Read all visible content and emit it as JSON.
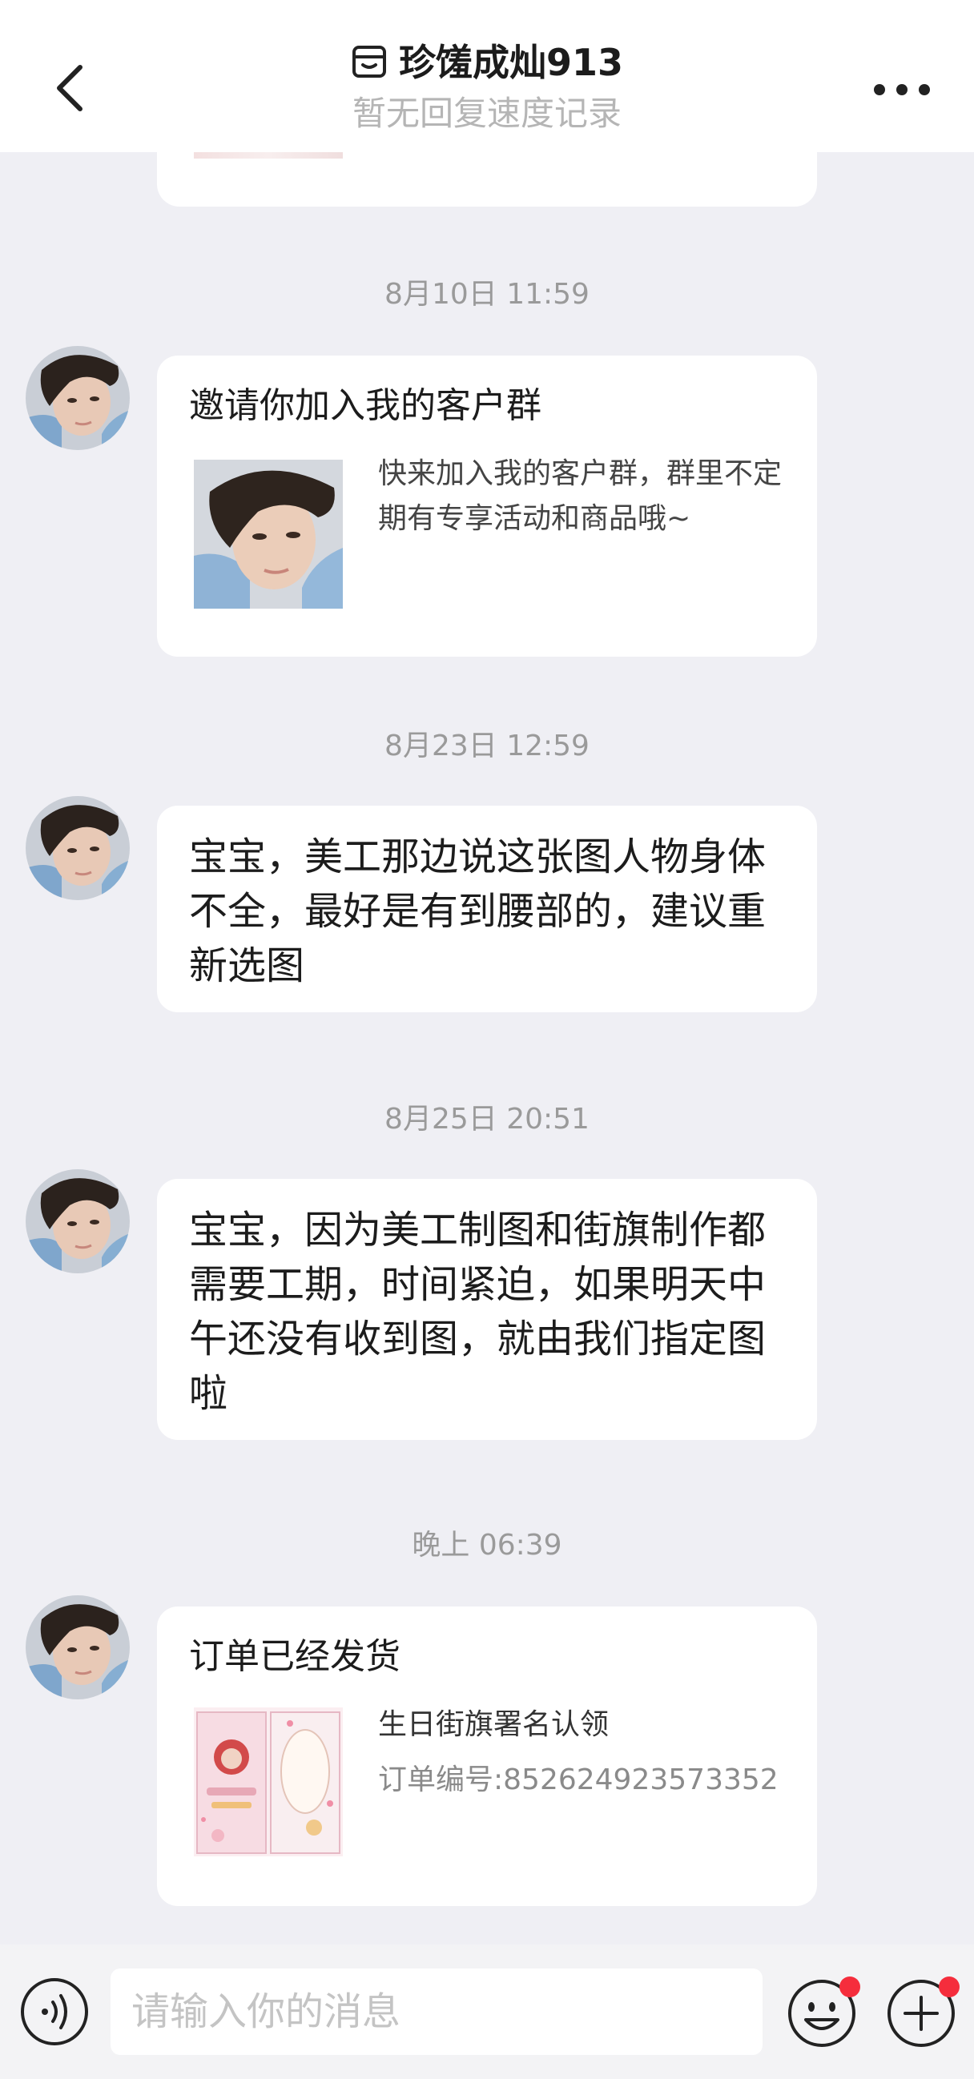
{
  "header": {
    "title": "珍馐成灿913",
    "subtitle": "暂无回复速度记录",
    "back_icon": "chevron-left-icon",
    "store_icon": "store-icon",
    "more_icon": "more-dots-icon"
  },
  "messages": [
    {
      "time": "8月10日 11:59",
      "type": "group-invite-card",
      "title": "邀请你加入我的客户群",
      "description": "快来加入我的客户群，群里不定期有专享活动和商品哦~"
    },
    {
      "time": "8月23日 12:59",
      "type": "text",
      "text": "宝宝，美工那边说这张图人物身体不全，最好是有到腰部的，建议重新选图"
    },
    {
      "time": "8月25日 20:51",
      "type": "text",
      "text": "宝宝，因为美工制图和街旗制作都需要工期，时间紧迫，如果明天中午还没有收到图，就由我们指定图啦"
    },
    {
      "time": "晚上 06:39",
      "type": "order-card",
      "title": "订单已经发货",
      "product": "生日街旗署名认领",
      "order_no": "订单编号:852624923573352"
    }
  ],
  "input_bar": {
    "placeholder": "请输入你的消息",
    "voice_icon": "voice-icon",
    "emoji_icon": "emoji-icon",
    "plus_icon": "plus-icon",
    "badge_color": "#f52d3c"
  },
  "colors": {
    "background": "#efeff4",
    "bubble": "#ffffff",
    "timestamp": "#9a9a9a"
  }
}
